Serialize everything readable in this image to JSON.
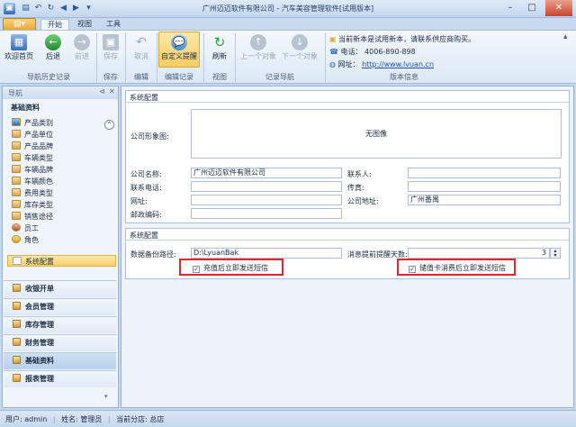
{
  "window": {
    "title": "广州迈迈软件有限公司 - 汽车美容管理软件[试用版本]"
  },
  "ribbon_tabs": {
    "file": "",
    "start": "开始",
    "view": "视图",
    "tools": "工具"
  },
  "ribbon": {
    "home": "欢迎首页",
    "back": "后退",
    "forward": "前进",
    "save": "保存",
    "cancel": "取消",
    "custom_reminder": "自定义提醒",
    "refresh": "刷新",
    "prev_record": "上一个对象",
    "next_record": "下一个对象",
    "groups": {
      "nav_history": "导航历史记录",
      "save": "保存",
      "edit": "编辑",
      "reminder": "编辑记录",
      "view": "视图",
      "record_nav": "记录导航",
      "version": "版本信息"
    },
    "version_info": {
      "notice": "当前新本是试用新本，请联系供应商购买。",
      "phone": "电话： 4006-890-898",
      "site_label": "网址：",
      "site_url": "http://www.lvuan.cn"
    }
  },
  "nav": {
    "header": "导航",
    "section": "基础资料",
    "items": [
      "产品类别",
      "产品单位",
      "产品品牌",
      "车辆类型",
      "车辆品牌",
      "车辆颜色",
      "费用类型",
      "库存类型",
      "销售途径",
      "员工",
      "角色",
      "系统配置"
    ],
    "modules": [
      "收银开单",
      "会员管理",
      "库存管理",
      "财务管理",
      "基础资料",
      "报表管理"
    ]
  },
  "config": {
    "section1": "系统配置",
    "logo_label": "公司形象图:",
    "logo_placeholder": "无图像",
    "company_name_label": "公司名称:",
    "company_name": "广州迈迈软件有限公司",
    "contact_label": "联系人:",
    "contact": "",
    "phone_label": "联系电话:",
    "phone": "",
    "fax_label": "传真:",
    "fax": "",
    "website_label": "网址:",
    "website": "",
    "address_label": "公司地址:",
    "address": "广州番禺",
    "zip_label": "邮政编码:",
    "zip": "",
    "section2": "系统配置",
    "backup_label": "数据备份路径:",
    "backup_path": "D:\\LyuanBak",
    "remind_days_label": "消息提前提醒天数:",
    "remind_days": "3",
    "sms_recharge": "充值后立即发送短信",
    "sms_consume": "储值卡消费后立即发送短信"
  },
  "status": {
    "user": "用户: admin",
    "name": "姓名: 管理员",
    "branch": "当前分店: 总店"
  },
  "colors": {
    "accent": "#f9d06a",
    "highlight_border": "#e2262a",
    "ribbon_bg": "#dce8f6"
  }
}
